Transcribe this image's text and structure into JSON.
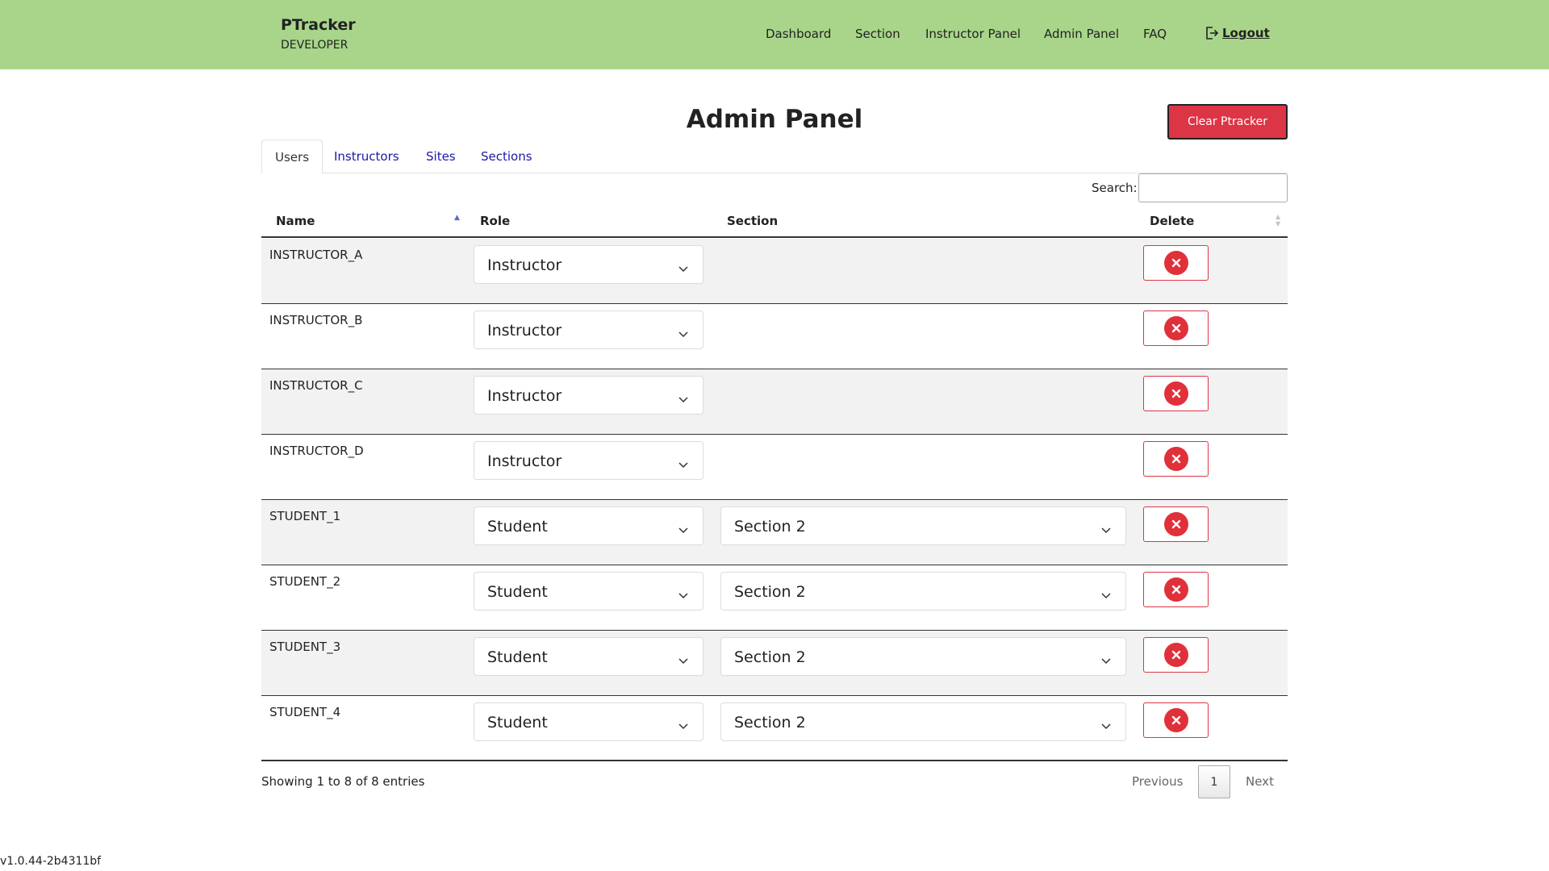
{
  "navbar": {
    "brand": "PTracker",
    "subtitle": "DEVELOPER",
    "links": [
      "Dashboard",
      "Section",
      "Instructor Panel",
      "Admin Panel",
      "FAQ"
    ],
    "logout": "Logout"
  },
  "page": {
    "title": "Admin Panel",
    "clear_button": "Clear Ptracker"
  },
  "tabs": [
    "Users",
    "Instructors",
    "Sites",
    "Sections"
  ],
  "search": {
    "label": "Search:",
    "value": ""
  },
  "table": {
    "headers": [
      "Name",
      "Role",
      "Section",
      "Delete"
    ],
    "rows": [
      {
        "name": "INSTRUCTOR_A",
        "role": "Instructor",
        "section": ""
      },
      {
        "name": "INSTRUCTOR_B",
        "role": "Instructor",
        "section": ""
      },
      {
        "name": "INSTRUCTOR_C",
        "role": "Instructor",
        "section": ""
      },
      {
        "name": "INSTRUCTOR_D",
        "role": "Instructor",
        "section": ""
      },
      {
        "name": "STUDENT_1",
        "role": "Student",
        "section": "Section 2"
      },
      {
        "name": "STUDENT_2",
        "role": "Student",
        "section": "Section 2"
      },
      {
        "name": "STUDENT_3",
        "role": "Student",
        "section": "Section 2"
      },
      {
        "name": "STUDENT_4",
        "role": "Student",
        "section": "Section 2"
      }
    ]
  },
  "footer": {
    "info": "Showing 1 to 8 of 8 entries",
    "previous": "Previous",
    "page": "1",
    "next": "Next"
  },
  "version": "v1.0.44-2b4311bf",
  "icons": {
    "logout": "logout-icon",
    "delete": "close-circle-icon",
    "select": "chevron-down-icon",
    "sort": "sort-icon"
  },
  "colors": {
    "navbar": "#a8d58a",
    "danger": "#dc3545",
    "tab_link": "#1a1aa6"
  }
}
